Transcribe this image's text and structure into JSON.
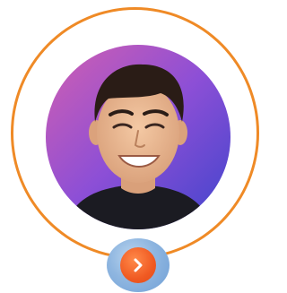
{
  "profile": {
    "avatar_icon": "person-portrait",
    "ring_color": "#ef8a26",
    "background_colors": [
      "#c45ab8",
      "#7a4fd6",
      "#4a46cf"
    ]
  },
  "next_button": {
    "icon": "chevron-right-icon",
    "color": "#f05a22",
    "halo_color": "#8fb6e0"
  }
}
